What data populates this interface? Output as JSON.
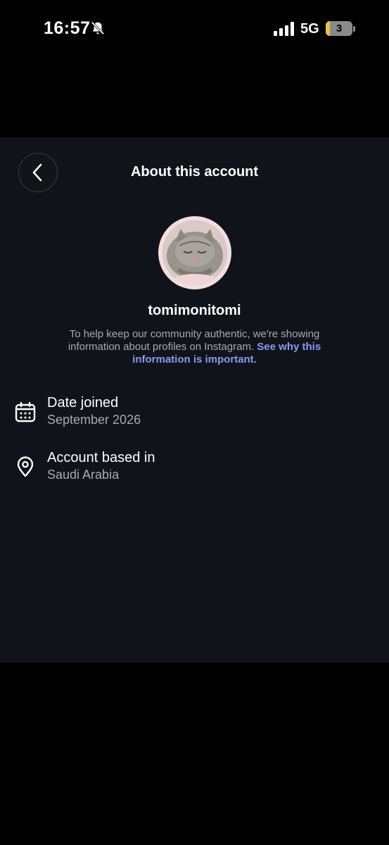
{
  "status_bar": {
    "time": "16:57",
    "network": "5G",
    "battery": "3",
    "icons": [
      "bell-slash-icon",
      "signal-bars-icon",
      "battery-icon"
    ]
  },
  "sheet": {
    "title": "About this account",
    "back_icon": "chevron-left-icon",
    "username": "tomimonitomi",
    "description_text": "To help keep our community authentic, we're showing information about profiles on Instagram. ",
    "description_link": "See why this information is important.",
    "link_color": "#8a99f3",
    "rows": [
      {
        "icon": "calendar-icon",
        "label": "Date joined",
        "value": "September 2026"
      },
      {
        "icon": "location-pin-icon",
        "label": "Account based in",
        "value": "Saudi Arabia"
      }
    ]
  },
  "colors": {
    "background": "#000000",
    "sheet": "#10131a",
    "secondary_text": "#a7aab1"
  }
}
